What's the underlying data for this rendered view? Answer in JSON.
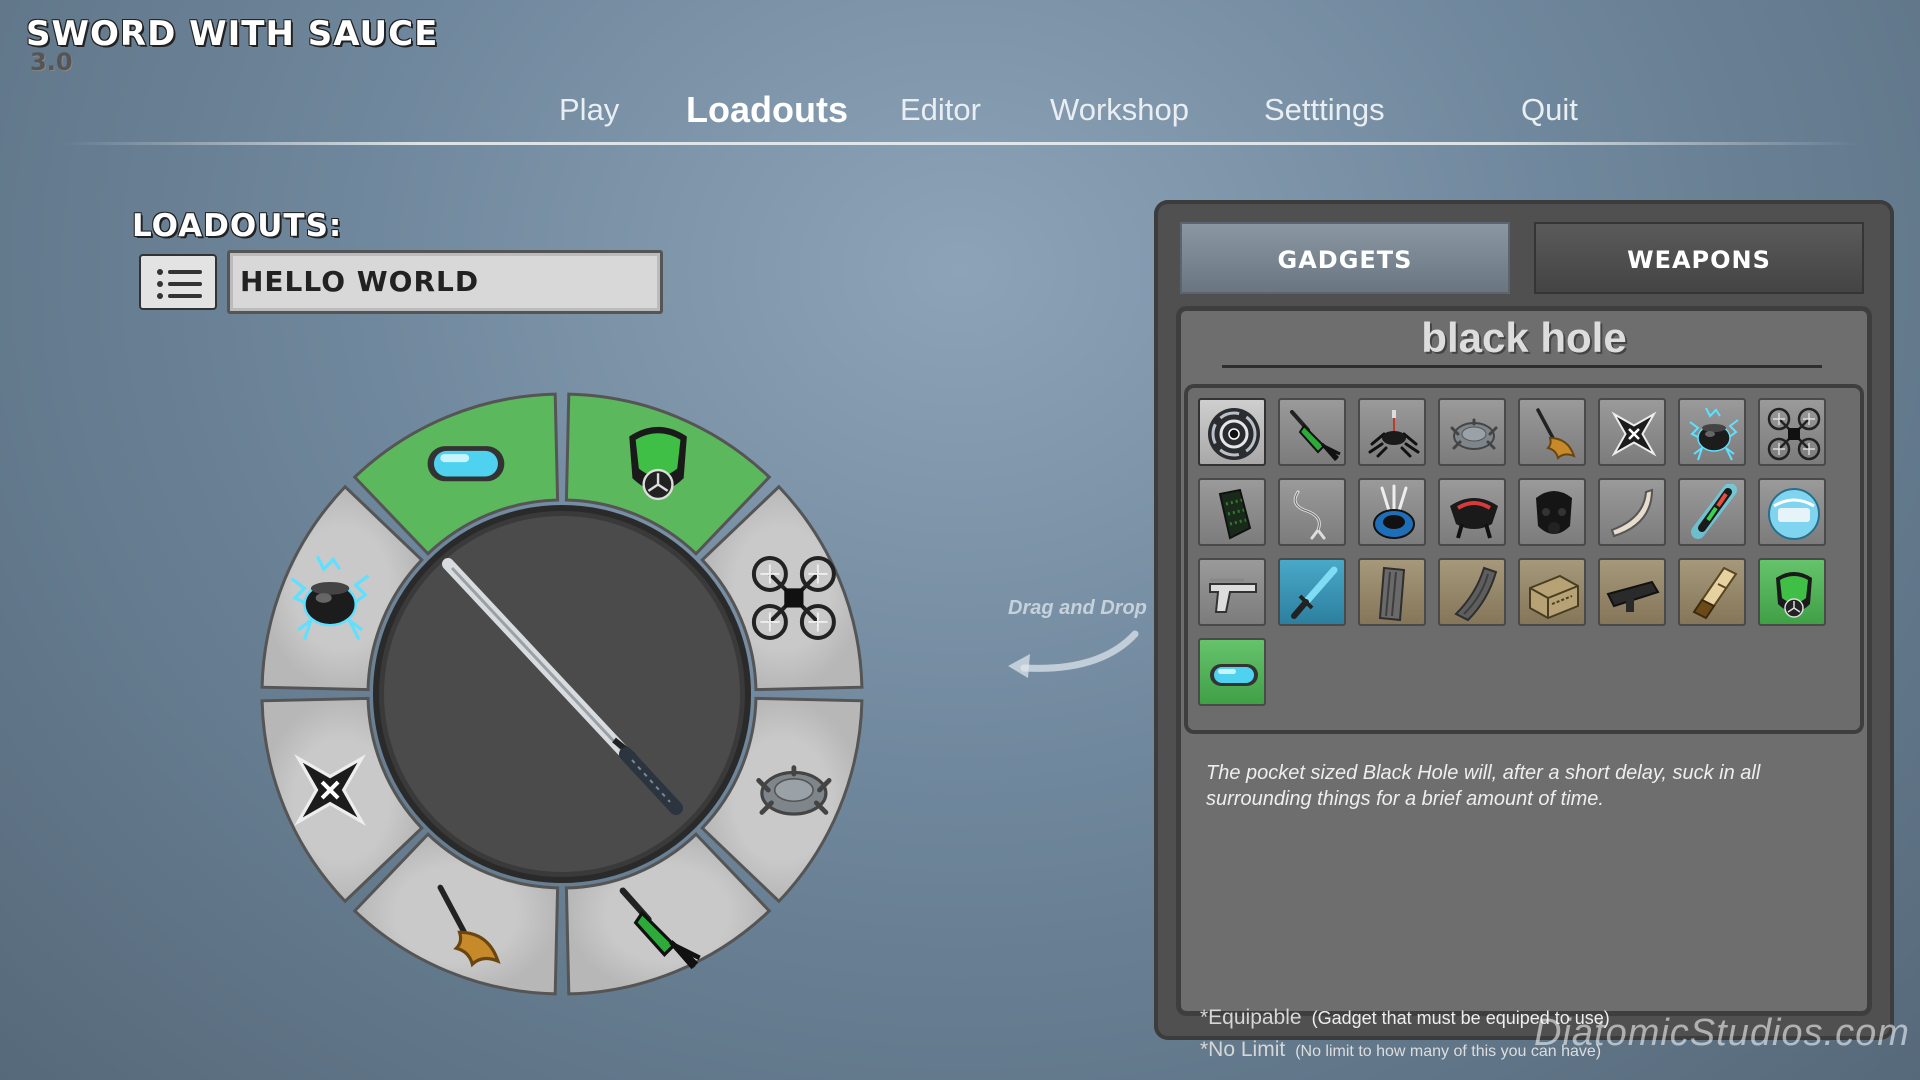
{
  "app": {
    "title": "SWORD WITH SAUCE",
    "version": "3.0"
  },
  "nav": {
    "items": [
      "Play",
      "Loadouts",
      "Editor",
      "Workshop",
      "Setttings",
      "Quit"
    ],
    "active": "Loadouts"
  },
  "loadouts": {
    "title": "LOADOUTS:",
    "current_name": "HELLO WORLD"
  },
  "wheel": {
    "center_weapon": "katana-icon",
    "slots": [
      {
        "icon": "goggles-icon",
        "highlighted": true
      },
      {
        "icon": "gas-mask-icon",
        "highlighted": true
      },
      {
        "icon": "drone-icon",
        "highlighted": false
      },
      {
        "icon": "turtle-mine-icon",
        "highlighted": false
      },
      {
        "icon": "dart-icon",
        "highlighted": false
      },
      {
        "icon": "broom-icon",
        "highlighted": false
      },
      {
        "icon": "shuriken-icon",
        "highlighted": false
      },
      {
        "icon": "electric-bomb-icon",
        "highlighted": false
      }
    ],
    "highlight_color": "#5cb85c"
  },
  "hint": {
    "drag_and_drop": "Drag and Drop"
  },
  "panel": {
    "tabs": [
      {
        "label": "GADGETS",
        "active": true
      },
      {
        "label": "WEAPONS",
        "active": false
      }
    ],
    "selected_item": "black hole",
    "grid_items": [
      "black-hole-icon",
      "dart-icon",
      "robot-spider-icon",
      "turtle-mine-icon",
      "broom-icon",
      "shuriken-icon",
      "electric-bomb-icon",
      "drone-icon",
      "grenade-canister-icon",
      "grappling-hook-icon",
      "smoke-pot-icon",
      "red-bot-icon",
      "dark-mask-icon",
      "boomerang-icon",
      "lightsaber-capsule-icon",
      "shield-orb-icon",
      "pistol-icon",
      "blue-sword-icon",
      "magazine-icon",
      "curved-magazine-icon",
      "ammo-box-icon",
      "scope-icon",
      "shotgun-shells-icon",
      "gas-mask-icon",
      "goggles-icon"
    ],
    "description": "The pocket sized Black Hole will, after a short delay, suck in all surrounding things for a brief amount of time.",
    "attributes": [
      {
        "name": "*Equipable",
        "note": "(Gadget that must be equiped to use)"
      },
      {
        "name": "*No Limit",
        "note": "(No limit to how many of this you can have)"
      }
    ]
  },
  "watermark": "DiatomicStudios.com"
}
